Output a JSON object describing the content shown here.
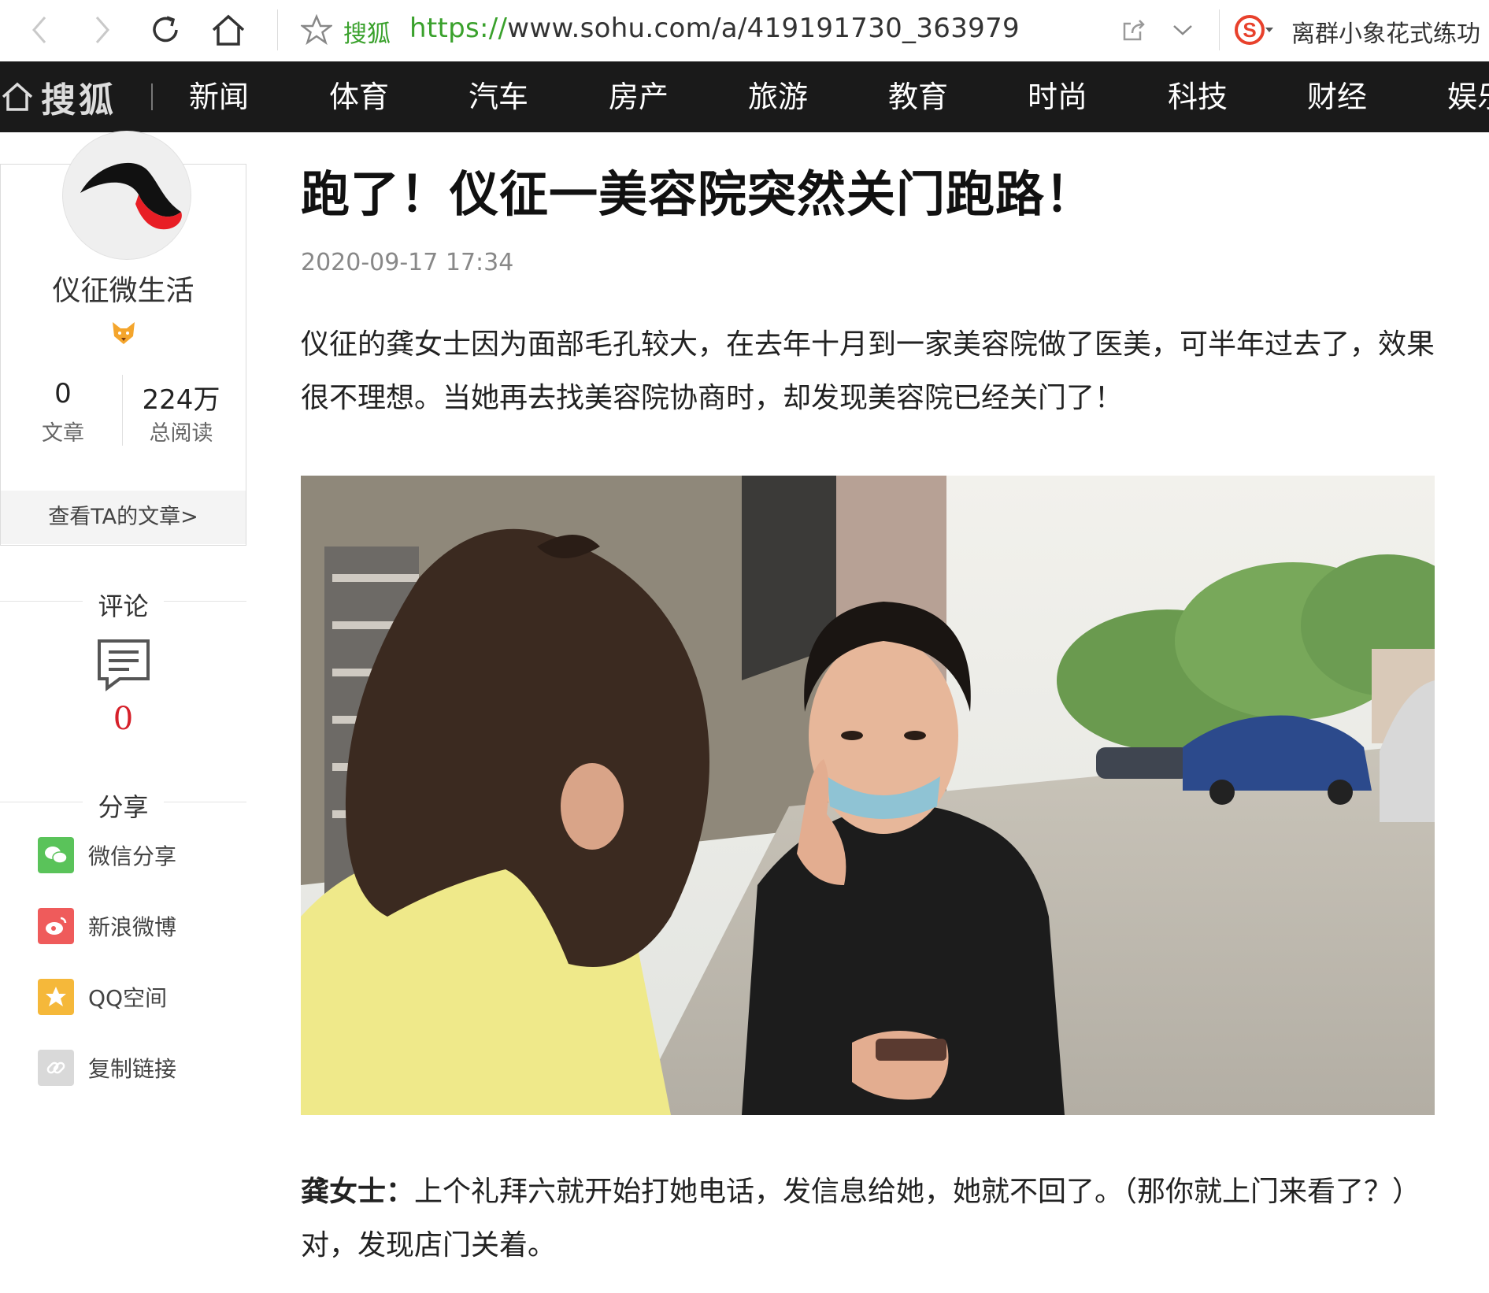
{
  "browser": {
    "site_name": "搜狐",
    "url_protocol": "https://",
    "url_rest": "www.sohu.com/a/419191730_363979",
    "news_ticker": "离群小象花式练功",
    "icons": [
      "back-icon",
      "forward-icon",
      "reload-icon",
      "home-icon",
      "star-icon",
      "share-icon",
      "chevron-down-icon",
      "sogou-icon"
    ]
  },
  "nav": {
    "brand": "搜狐",
    "items": [
      "新闻",
      "体育",
      "汽车",
      "房产",
      "旅游",
      "教育",
      "时尚",
      "科技",
      "财经",
      "娱乐"
    ]
  },
  "author": {
    "name": "仪征微生活",
    "articles_count": "0",
    "articles_label": "文章",
    "reads_count": "224万",
    "reads_label": "总阅读",
    "view_articles": "查看TA的文章>"
  },
  "comments": {
    "title": "评论",
    "count": "0"
  },
  "share": {
    "title": "分享",
    "items": [
      {
        "label": "微信分享",
        "icon": "wechat-icon",
        "color": "#5ac35a"
      },
      {
        "label": "新浪微博",
        "icon": "weibo-icon",
        "color": "#ef5b5b"
      },
      {
        "label": "QQ空间",
        "icon": "qzone-icon",
        "color": "#f5b83a"
      },
      {
        "label": "复制链接",
        "icon": "link-icon",
        "color": "#d9d9d9"
      }
    ]
  },
  "article": {
    "title": "跑了！仪征一美容院突然关门跑路！",
    "date": "2020-09-17 17:34",
    "intro": "仪征的龚女士因为面部毛孔较大，在去年十月到一家美容院做了医美，可半年过去了，效果很不理想。当她再去找美容院协商时，却发现美容院已经关门了！",
    "quote_speaker": "龚女士：",
    "quote_text": "上个礼拜六就开始打她电话，发信息给她，她就不回了。（那你就上门来看了？）对，发现店门关着。"
  },
  "colors": {
    "nav_bg": "#1a1a1a",
    "url_green": "#3aa12c",
    "comment_red": "#d6202a"
  }
}
